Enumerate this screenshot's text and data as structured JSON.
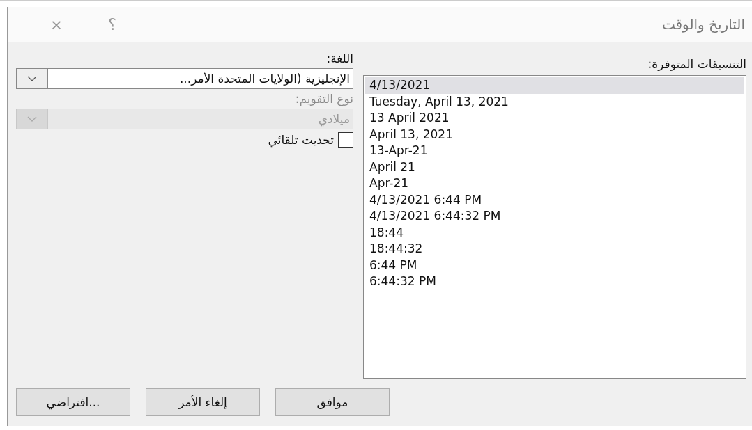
{
  "window": {
    "title": "التاريخ والوقت",
    "help": "؟",
    "close": "×"
  },
  "formats": {
    "label": "التنسيقات المتوفرة:",
    "items": [
      {
        "text": "4/13/2021",
        "selected": true
      },
      {
        "text": "Tuesday, April 13, 2021",
        "selected": false
      },
      {
        "text": "13 April 2021",
        "selected": false
      },
      {
        "text": "April 13, 2021",
        "selected": false
      },
      {
        "text": "13-Apr-21",
        "selected": false
      },
      {
        "text": "April 21",
        "selected": false
      },
      {
        "text": "Apr-21",
        "selected": false
      },
      {
        "text": "4/13/2021 6:44 PM",
        "selected": false
      },
      {
        "text": "4/13/2021 6:44:32 PM",
        "selected": false
      },
      {
        "text": "18:44",
        "selected": false
      },
      {
        "text": "18:44:32",
        "selected": false
      },
      {
        "text": "6:44 PM",
        "selected": false
      },
      {
        "text": "6:44:32 PM",
        "selected": false
      }
    ]
  },
  "language": {
    "label": "اللغة:",
    "value": "الإنجليزية (الولايات المتحدة الأمر...",
    "disabled": false
  },
  "calendar": {
    "label": "نوع التقويم:",
    "value": "ميلادي",
    "disabled": true
  },
  "auto_update": {
    "label": "تحديث تلقائي",
    "checked": false
  },
  "buttons": [
    "موافق",
    "إلغاء الأمر",
    "افتراضي..."
  ]
}
